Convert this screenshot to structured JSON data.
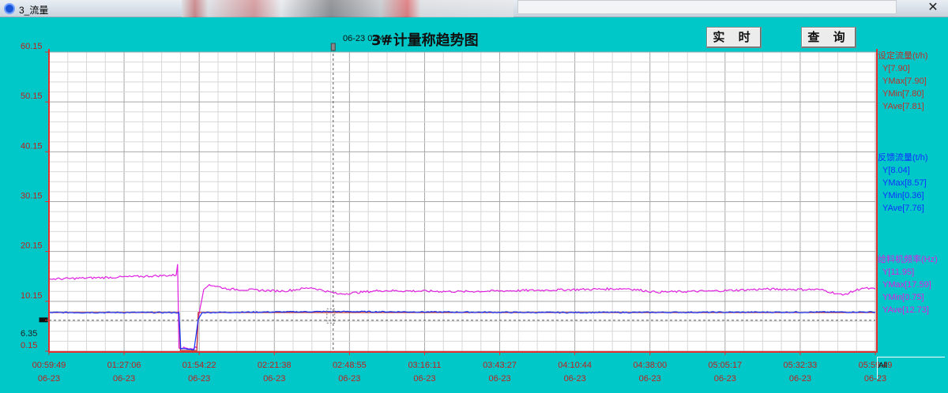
{
  "window": {
    "title": "3_流量",
    "close_glyph": "✕"
  },
  "toolbar": {
    "realtime_label": "实 时",
    "query_label": "查 询"
  },
  "chart_title": "3#计量称趋势图",
  "cursor": {
    "label": "06-23 02:43",
    "time": "02:43:00"
  },
  "all_label": "All",
  "colors": {
    "background": "#00c8c8",
    "plot_bg": "#ffffff",
    "grid": "#b4b4b4",
    "axis": "#e03030",
    "setpoint": "#c0302a",
    "feedback": "#1030ff",
    "feeder": "#e020e0"
  },
  "legend": [
    {
      "name": "设定流量(t/h)",
      "stats": [
        "Y[7.90]",
        "YMax[7.90]",
        "YMin[7.80]",
        "YAve[7.81]"
      ]
    },
    {
      "name": "反馈流量(t/h)",
      "stats": [
        "Y[8.04]",
        "YMax[8.57]",
        "YMin[0.36]",
        "YAve[7.76]"
      ]
    },
    {
      "name": "给料机频率(Hz)",
      "stats": [
        "Y[11.95]",
        "YMax[17.59]",
        "YMin[0.75]",
        "YAve[12.73]"
      ]
    }
  ],
  "chart_data": {
    "type": "line",
    "title": "3#计量称趋势图",
    "x_date": "06-23",
    "x_ticks": [
      "00:59:49",
      "01:27:06",
      "01:54:22",
      "02:21:38",
      "02:48:55",
      "03:16:11",
      "03:43:27",
      "04:10:44",
      "04:38:00",
      "05:05:17",
      "05:32:33",
      "05:59:49"
    ],
    "y_ticks": [
      "60.15",
      "50.15",
      "40.15",
      "30.15",
      "20.15",
      "10.15",
      "6.35",
      "0.15"
    ],
    "ylim": [
      0.15,
      60.15
    ],
    "reference_line": 6.35,
    "grid": true,
    "series": [
      {
        "name": "设定流量(t/h)",
        "points": [
          [
            "00:59:49",
            7.9
          ],
          [
            "01:47:00",
            7.9
          ],
          [
            "01:47:30",
            0.3
          ],
          [
            "01:53:30",
            0.3
          ],
          [
            "01:54:00",
            7.9
          ],
          [
            "02:43:00",
            7.9
          ],
          [
            "05:59:49",
            7.9
          ]
        ]
      },
      {
        "name": "反馈流量(t/h)",
        "points": [
          [
            "00:59:49",
            7.9
          ],
          [
            "01:47:00",
            7.9
          ],
          [
            "01:47:40",
            0.6
          ],
          [
            "01:52:30",
            0.5
          ],
          [
            "01:54:00",
            6.5
          ],
          [
            "01:55:30",
            7.9
          ],
          [
            "02:43:00",
            8.1
          ],
          [
            "04:00:00",
            7.9
          ],
          [
            "05:59:49",
            8.0
          ]
        ]
      },
      {
        "name": "给料机频率(Hz)",
        "points": [
          [
            "00:59:49",
            14.6
          ],
          [
            "01:25:00",
            15.0
          ],
          [
            "01:46:00",
            15.4
          ],
          [
            "01:46:30",
            17.6
          ],
          [
            "01:47:00",
            0.8
          ],
          [
            "01:53:30",
            0.8
          ],
          [
            "01:54:00",
            6.8
          ],
          [
            "01:56:00",
            12.5
          ],
          [
            "01:58:00",
            13.5
          ],
          [
            "02:05:00",
            12.6
          ],
          [
            "02:25:00",
            12.2
          ],
          [
            "02:35:00",
            12.9
          ],
          [
            "02:45:00",
            11.6
          ],
          [
            "03:00:00",
            12.3
          ],
          [
            "03:30:00",
            12.1
          ],
          [
            "04:00:00",
            12.4
          ],
          [
            "04:30:00",
            12.7
          ],
          [
            "04:40:00",
            12.0
          ],
          [
            "05:00:00",
            12.2
          ],
          [
            "05:20:00",
            12.6
          ],
          [
            "05:40:00",
            12.5
          ],
          [
            "05:48:00",
            11.4
          ],
          [
            "05:55:00",
            12.8
          ],
          [
            "05:59:49",
            12.6
          ]
        ]
      }
    ]
  }
}
